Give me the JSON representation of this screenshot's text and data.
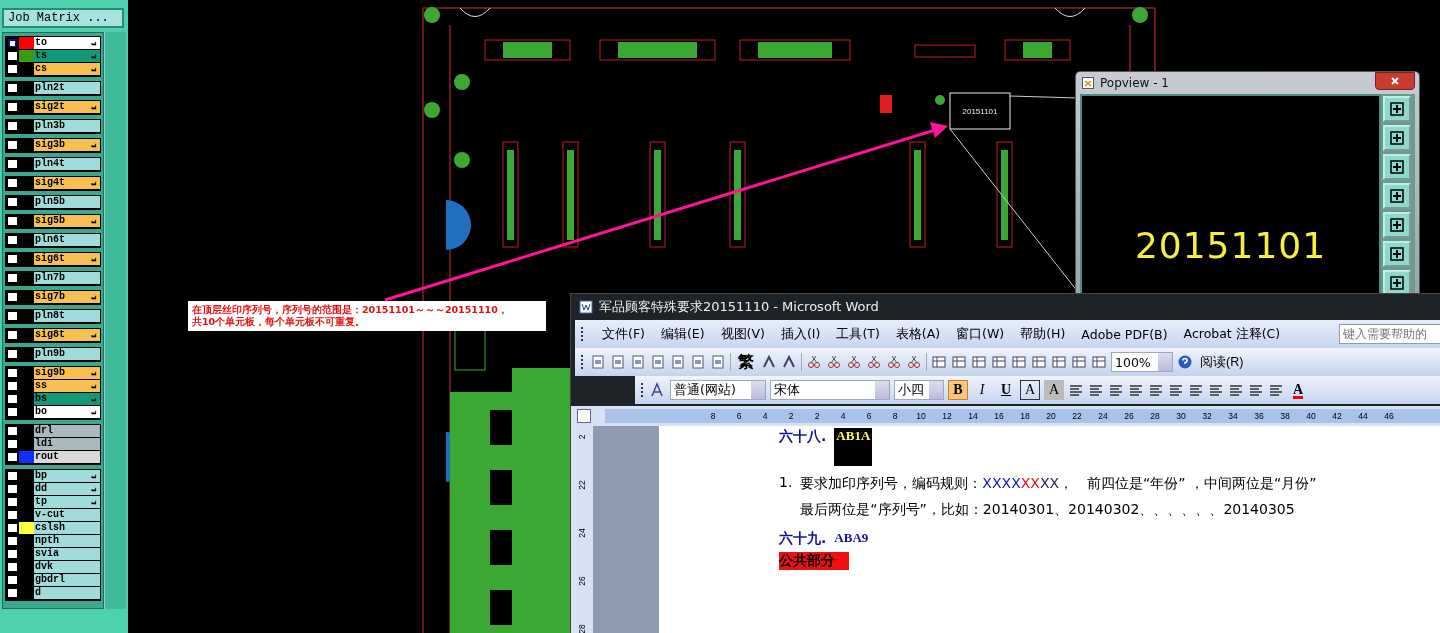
{
  "layer_panel": {
    "matrix_button": "Job Matrix ...",
    "groups": [
      [
        {
          "name": "to",
          "kind": "silk",
          "color": "#ff0000",
          "hand": true,
          "selected": true
        },
        {
          "name": "ts",
          "kind": "mask",
          "color": "#3a9a10",
          "hand": true,
          "selected": false
        },
        {
          "name": "cs",
          "kind": "signal",
          "hand": true,
          "selected": false
        }
      ],
      [
        {
          "name": "pln2t",
          "kind": "plane",
          "hand": false,
          "selected": false
        }
      ],
      [
        {
          "name": "sig2t",
          "kind": "signal",
          "hand": true,
          "selected": false
        }
      ],
      [
        {
          "name": "pln3b",
          "kind": "plane",
          "hand": false,
          "selected": false
        }
      ],
      [
        {
          "name": "sig3b",
          "kind": "signal",
          "hand": true,
          "selected": false
        }
      ],
      [
        {
          "name": "pln4t",
          "kind": "plane",
          "hand": false,
          "selected": false
        }
      ],
      [
        {
          "name": "sig4t",
          "kind": "signal",
          "hand": true,
          "selected": false
        }
      ],
      [
        {
          "name": "pln5b",
          "kind": "plane",
          "hand": false,
          "selected": false
        }
      ],
      [
        {
          "name": "sig5b",
          "kind": "signal",
          "hand": true,
          "selected": false
        }
      ],
      [
        {
          "name": "pln6t",
          "kind": "plane",
          "hand": false,
          "selected": false
        }
      ],
      [
        {
          "name": "sig6t",
          "kind": "signal",
          "hand": true,
          "selected": false
        }
      ],
      [
        {
          "name": "pln7b",
          "kind": "plane",
          "hand": false,
          "selected": false
        }
      ],
      [
        {
          "name": "sig7b",
          "kind": "signal",
          "hand": true,
          "selected": false
        }
      ],
      [
        {
          "name": "pln8t",
          "kind": "plane",
          "hand": false,
          "selected": false
        }
      ],
      [
        {
          "name": "sig8t",
          "kind": "signal",
          "hand": true,
          "selected": false
        }
      ],
      [
        {
          "name": "pln9b",
          "kind": "plane",
          "hand": false,
          "selected": false
        }
      ],
      [
        {
          "name": "sig9b",
          "kind": "signal",
          "hand": true,
          "selected": false
        },
        {
          "name": "ss",
          "kind": "signal",
          "hand": true,
          "selected": false
        },
        {
          "name": "bs",
          "kind": "mask",
          "hand": true,
          "selected": false
        },
        {
          "name": "bo",
          "kind": "silk",
          "hand": true,
          "selected": false
        }
      ],
      [
        {
          "name": "drl",
          "kind": "drill",
          "hand": false,
          "selected": false
        },
        {
          "name": "ldi",
          "kind": "drill",
          "hand": false,
          "selected": false
        },
        {
          "name": "rout",
          "kind": "rout",
          "color": "#1030ff",
          "hand": false,
          "selected": false
        }
      ],
      [
        {
          "name": "bp",
          "kind": "document",
          "hand": true,
          "selected": false
        },
        {
          "name": "dd",
          "kind": "document",
          "hand": true,
          "selected": false
        },
        {
          "name": "tp",
          "kind": "document",
          "hand": true,
          "selected": false
        },
        {
          "name": "v-cut",
          "kind": "document",
          "hand": false,
          "selected": false
        },
        {
          "name": "cslsh",
          "kind": "document",
          "color": "#ffff40",
          "hand": false,
          "selected": false
        },
        {
          "name": "npth",
          "kind": "document",
          "hand": false,
          "selected": false
        },
        {
          "name": "svia",
          "kind": "document",
          "hand": false,
          "selected": false
        },
        {
          "name": "dvk",
          "kind": "document",
          "hand": false,
          "selected": false
        },
        {
          "name": "gbdrl",
          "kind": "document",
          "hand": false,
          "selected": false
        },
        {
          "name": "d",
          "kind": "document",
          "hand": false,
          "selected": false
        }
      ]
    ]
  },
  "canvas": {
    "board_label": "20151101",
    "annotation": [
      "在顶层丝印序列号，序列号的范围是：20151101～～～20151110，",
      "共10个单元板，每个单元板不可重复。"
    ]
  },
  "popview": {
    "title": "Popview - 1",
    "value": "20151101"
  },
  "word": {
    "title": "军品顾客特殊要求20151110 - Microsoft Word",
    "menu": [
      "文件(F)",
      "编辑(E)",
      "视图(V)",
      "插入(I)",
      "工具(T)",
      "表格(A)",
      "窗口(W)",
      "帮助(H)",
      "Adobe PDF(B)",
      "Acrobat 注释(C)"
    ],
    "help_placeholder": "键入需要帮助的",
    "standard_toolbar": {
      "traditional": "繁",
      "zoom": "100%",
      "read_button": "阅读(R)"
    },
    "format_toolbar": {
      "style": "普通(网站)",
      "font": "宋体",
      "size": "小四",
      "buttons": [
        {
          "label": "B",
          "kind": "bold",
          "on": true
        },
        {
          "label": "I",
          "kind": "italic",
          "on": false
        },
        {
          "label": "U",
          "kind": "underline",
          "on": false
        },
        {
          "label": "A",
          "kind": "border",
          "on": false
        },
        {
          "label": "A",
          "kind": "shading",
          "on": false
        }
      ],
      "font_color": "A"
    },
    "ruler": {
      "h": [
        "8",
        "6",
        "4",
        "2",
        "2",
        "4",
        "6",
        "8",
        "10",
        "12",
        "14",
        "16",
        "18",
        "20",
        "22",
        "24",
        "26",
        "28",
        "30",
        "32",
        "34",
        "36",
        "38",
        "40",
        "42",
        "44",
        "46"
      ],
      "v": [
        "2",
        "22",
        "24",
        "26",
        "28"
      ]
    },
    "document": {
      "heading_1": {
        "number": "六十八.",
        "code": "AB1A"
      },
      "item": {
        "number": "1.",
        "segments": [
          {
            "text": "要求加印序列号，编码规则：",
            "color": "#000000"
          },
          {
            "text": "XXXX",
            "color": "#1010c0"
          },
          {
            "text": "XX",
            "color": "#e01010"
          },
          {
            "text": "XX",
            "color": "#202060"
          },
          {
            "text": "，　前四位是“年份” ，中间两位是“月份”　　最后两位是“序列号”，比如：20140301、20140302、、、、、、20140305",
            "color": "#000000"
          }
        ]
      },
      "heading_2": {
        "number": "六十九.",
        "code": "ABA9"
      },
      "section_tag": "公共部分"
    }
  }
}
